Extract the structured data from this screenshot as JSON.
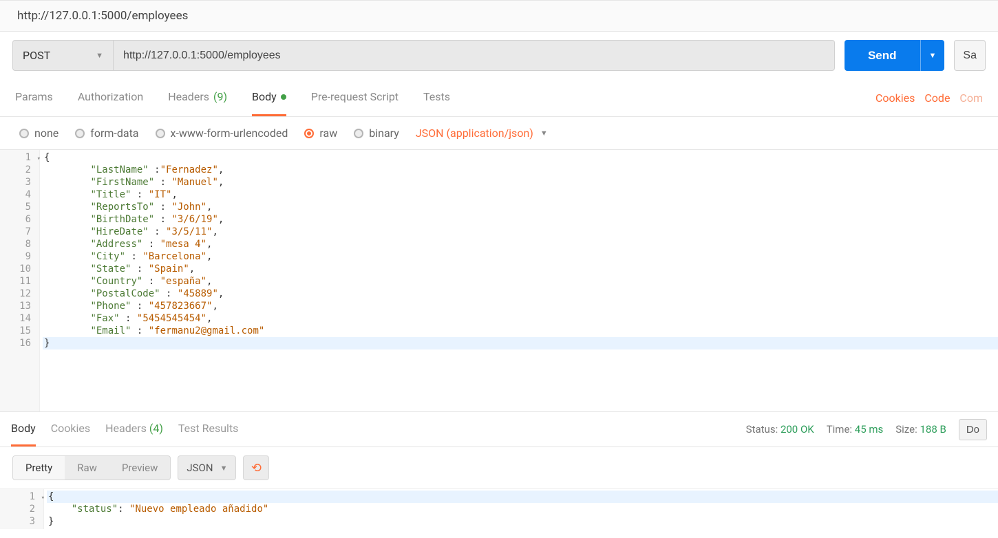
{
  "url_bar": "http://127.0.0.1:5000/employees",
  "request": {
    "method": "POST",
    "url": "http://127.0.0.1:5000/employees",
    "send_label": "Send",
    "save_label": "Sa"
  },
  "tabs": {
    "params": "Params",
    "auth": "Authorization",
    "headers": "Headers",
    "headers_count": "(9)",
    "body": "Body",
    "prerequest": "Pre-request Script",
    "tests": "Tests",
    "cookies_link": "Cookies",
    "code_link": "Code",
    "comments_link": "Com"
  },
  "body_types": {
    "none": "none",
    "form_data": "form-data",
    "x_www": "x-www-form-urlencoded",
    "raw": "raw",
    "binary": "binary",
    "content_type": "JSON (application/json)"
  },
  "request_body_lines": [
    [
      {
        "t": "{",
        "c": "punc"
      }
    ],
    [
      {
        "t": "        ",
        "c": "plain"
      },
      {
        "t": "\"LastName\"",
        "c": "key"
      },
      {
        "t": " :",
        "c": "punc"
      },
      {
        "t": "\"Fernadez\"",
        "c": "str"
      },
      {
        "t": ",",
        "c": "punc"
      }
    ],
    [
      {
        "t": "        ",
        "c": "plain"
      },
      {
        "t": "\"FirstName\"",
        "c": "key"
      },
      {
        "t": " : ",
        "c": "punc"
      },
      {
        "t": "\"Manuel\"",
        "c": "str"
      },
      {
        "t": ",",
        "c": "punc"
      }
    ],
    [
      {
        "t": "        ",
        "c": "plain"
      },
      {
        "t": "\"Title\"",
        "c": "key"
      },
      {
        "t": " : ",
        "c": "punc"
      },
      {
        "t": "\"IT\"",
        "c": "str"
      },
      {
        "t": ",",
        "c": "punc"
      }
    ],
    [
      {
        "t": "        ",
        "c": "plain"
      },
      {
        "t": "\"ReportsTo\"",
        "c": "key"
      },
      {
        "t": " : ",
        "c": "punc"
      },
      {
        "t": "\"John\"",
        "c": "str"
      },
      {
        "t": ",",
        "c": "punc"
      }
    ],
    [
      {
        "t": "        ",
        "c": "plain"
      },
      {
        "t": "\"BirthDate\"",
        "c": "key"
      },
      {
        "t": " : ",
        "c": "punc"
      },
      {
        "t": "\"3/6/19\"",
        "c": "str"
      },
      {
        "t": ",",
        "c": "punc"
      }
    ],
    [
      {
        "t": "        ",
        "c": "plain"
      },
      {
        "t": "\"HireDate\"",
        "c": "key"
      },
      {
        "t": " : ",
        "c": "punc"
      },
      {
        "t": "\"3/5/11\"",
        "c": "str"
      },
      {
        "t": ",",
        "c": "punc"
      }
    ],
    [
      {
        "t": "        ",
        "c": "plain"
      },
      {
        "t": "\"Address\"",
        "c": "key"
      },
      {
        "t": " : ",
        "c": "punc"
      },
      {
        "t": "\"mesa 4\"",
        "c": "str"
      },
      {
        "t": ",",
        "c": "punc"
      }
    ],
    [
      {
        "t": "        ",
        "c": "plain"
      },
      {
        "t": "\"City\"",
        "c": "key"
      },
      {
        "t": " : ",
        "c": "punc"
      },
      {
        "t": "\"Barcelona\"",
        "c": "str"
      },
      {
        "t": ",",
        "c": "punc"
      }
    ],
    [
      {
        "t": "        ",
        "c": "plain"
      },
      {
        "t": "\"State\"",
        "c": "key"
      },
      {
        "t": " : ",
        "c": "punc"
      },
      {
        "t": "\"Spain\"",
        "c": "str"
      },
      {
        "t": ",",
        "c": "punc"
      }
    ],
    [
      {
        "t": "        ",
        "c": "plain"
      },
      {
        "t": "\"Country\"",
        "c": "key"
      },
      {
        "t": " : ",
        "c": "punc"
      },
      {
        "t": "\"españa\"",
        "c": "str"
      },
      {
        "t": ",",
        "c": "punc"
      }
    ],
    [
      {
        "t": "        ",
        "c": "plain"
      },
      {
        "t": "\"PostalCode\"",
        "c": "key"
      },
      {
        "t": " : ",
        "c": "punc"
      },
      {
        "t": "\"45889\"",
        "c": "str"
      },
      {
        "t": ",",
        "c": "punc"
      }
    ],
    [
      {
        "t": "        ",
        "c": "plain"
      },
      {
        "t": "\"Phone\"",
        "c": "key"
      },
      {
        "t": " : ",
        "c": "punc"
      },
      {
        "t": "\"457823667\"",
        "c": "str"
      },
      {
        "t": ",",
        "c": "punc"
      }
    ],
    [
      {
        "t": "        ",
        "c": "plain"
      },
      {
        "t": "\"Fax\"",
        "c": "key"
      },
      {
        "t": " : ",
        "c": "punc"
      },
      {
        "t": "\"5454545454\"",
        "c": "str"
      },
      {
        "t": ",",
        "c": "punc"
      }
    ],
    [
      {
        "t": "        ",
        "c": "plain"
      },
      {
        "t": "\"Email\"",
        "c": "key"
      },
      {
        "t": " : ",
        "c": "punc"
      },
      {
        "t": "\"fermanu2@gmail.com\"",
        "c": "str"
      }
    ],
    [
      {
        "t": "}",
        "c": "punc"
      }
    ]
  ],
  "highlight_request_line": 16,
  "response_tabs": {
    "body": "Body",
    "cookies": "Cookies",
    "headers": "Headers",
    "headers_count": "(4)",
    "results": "Test Results"
  },
  "response_meta": {
    "status_label": "Status:",
    "status_value": "200 OK",
    "time_label": "Time:",
    "time_value": "45 ms",
    "size_label": "Size:",
    "size_value": "188 B",
    "download": "Do"
  },
  "response_toolbar": {
    "pretty": "Pretty",
    "raw": "Raw",
    "preview": "Preview",
    "format": "JSON"
  },
  "response_body_lines": [
    [
      {
        "t": "{",
        "c": "punc"
      }
    ],
    [
      {
        "t": "    ",
        "c": "plain"
      },
      {
        "t": "\"status\"",
        "c": "key"
      },
      {
        "t": ": ",
        "c": "punc"
      },
      {
        "t": "\"Nuevo empleado añadido\"",
        "c": "str"
      }
    ],
    [
      {
        "t": "}",
        "c": "punc"
      }
    ]
  ],
  "highlight_response_line": 1
}
